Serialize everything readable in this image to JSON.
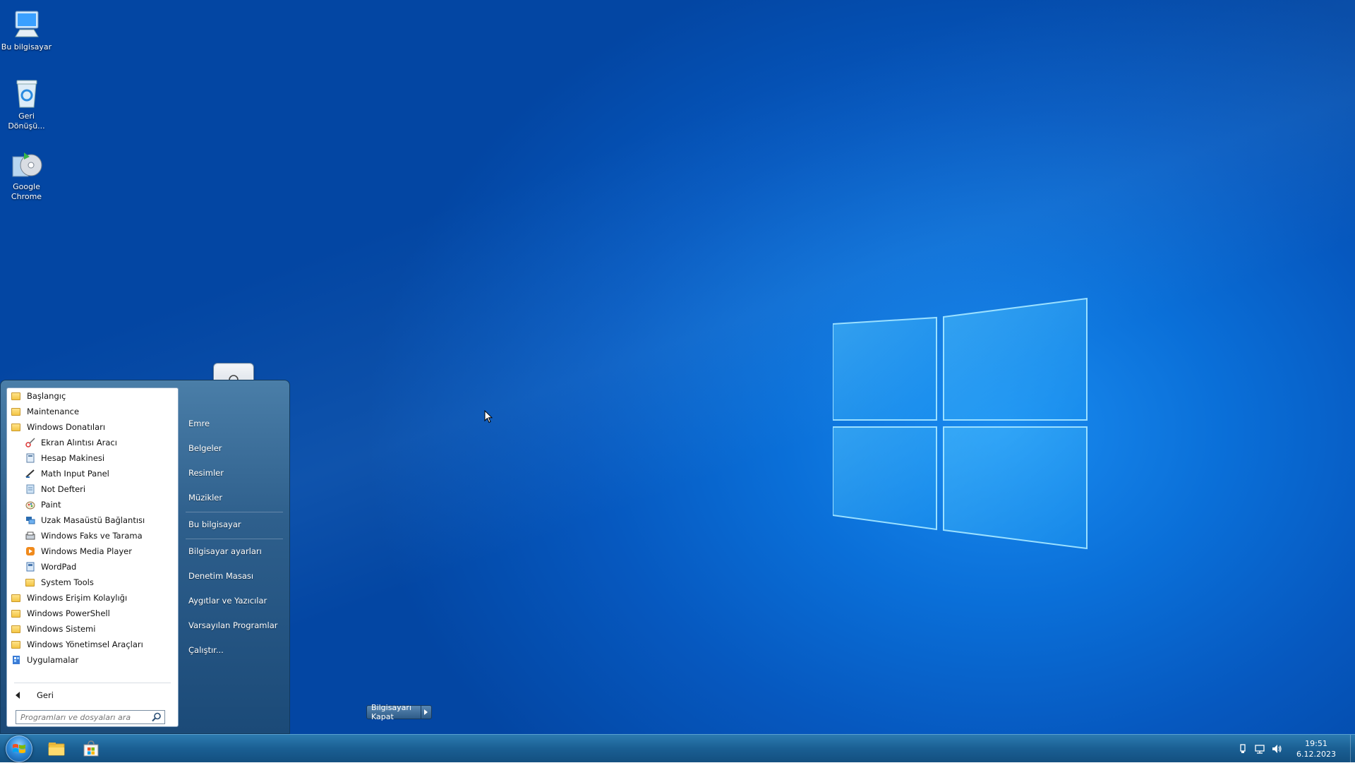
{
  "colors": {
    "desktop_blue": "#0a6fd8",
    "start_menu_blue": "#2e5f8c",
    "taskbar_blue": "#1a5f93"
  },
  "desktop": {
    "icons": [
      {
        "label": "Bu bilgisayar",
        "icon": "computer-icon"
      },
      {
        "label": "Geri Dönüşü...",
        "icon": "recycle-bin-icon"
      },
      {
        "label": "Google Chrome",
        "icon": "chrome-installer-icon"
      }
    ]
  },
  "start_menu": {
    "programs": [
      {
        "label": "Başlangıç",
        "icon": "folder-icon"
      },
      {
        "label": "Maintenance",
        "icon": "folder-icon"
      },
      {
        "label": "Windows Donatıları",
        "icon": "folder-icon"
      },
      {
        "label": "Ekran Alıntısı Aracı",
        "icon": "snipping-tool-icon"
      },
      {
        "label": "Hesap Makinesi",
        "icon": "calculator-icon"
      },
      {
        "label": "Math Input Panel",
        "icon": "math-input-icon"
      },
      {
        "label": "Not Defteri",
        "icon": "notepad-icon"
      },
      {
        "label": "Paint",
        "icon": "paint-icon"
      },
      {
        "label": "Uzak Masaüstü Bağlantısı",
        "icon": "remote-desktop-icon"
      },
      {
        "label": "Windows Faks ve Tarama",
        "icon": "fax-scan-icon"
      },
      {
        "label": "Windows Media Player",
        "icon": "media-player-icon"
      },
      {
        "label": "WordPad",
        "icon": "wordpad-icon"
      },
      {
        "label": "System Tools",
        "icon": "folder-icon"
      },
      {
        "label": "Windows Erişim Kolaylığı",
        "icon": "folder-icon"
      },
      {
        "label": "Windows PowerShell",
        "icon": "folder-icon"
      },
      {
        "label": "Windows Sistemi",
        "icon": "folder-icon"
      },
      {
        "label": "Windows Yönetimsel Araçları",
        "icon": "folder-icon"
      },
      {
        "label": "Uygulamalar",
        "icon": "apps-icon"
      }
    ],
    "back_label": "Geri",
    "search_placeholder": "Programları ve dosyaları ara",
    "right_items": [
      {
        "label": "Emre"
      },
      {
        "label": "Belgeler"
      },
      {
        "label": "Resimler"
      },
      {
        "label": "Müzikler"
      },
      {
        "label": "Bu bilgisayar"
      },
      {
        "label": "Bilgisayar ayarları"
      },
      {
        "label": "Denetim Masası"
      },
      {
        "label": "Aygıtlar ve Yazıcılar"
      },
      {
        "label": "Varsayılan Programlar"
      },
      {
        "label": "Çalıştır..."
      }
    ],
    "shutdown_label": "Bilgisayarı Kapat",
    "user_icon": "user-icon"
  },
  "taskbar": {
    "pinned": [
      {
        "name": "File Explorer",
        "icon": "folder-explorer-icon"
      },
      {
        "name": "Microsoft Store",
        "icon": "store-icon"
      }
    ],
    "tray_icons": [
      "usb-icon",
      "network-icon",
      "volume-icon"
    ],
    "time": "19:51",
    "date": "6.12.2023"
  }
}
